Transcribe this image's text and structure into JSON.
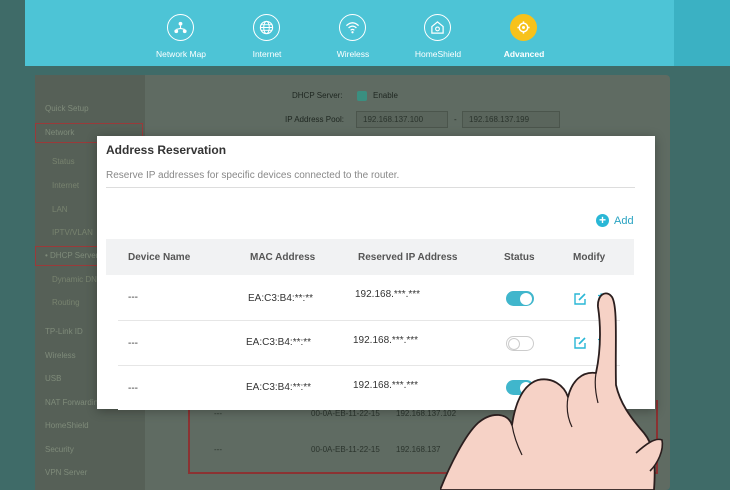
{
  "nav": {
    "items": [
      {
        "label": "Network Map",
        "icon": "network-map-icon"
      },
      {
        "label": "Internet",
        "icon": "globe-icon"
      },
      {
        "label": "Wireless",
        "icon": "wifi-icon"
      },
      {
        "label": "HomeShield",
        "icon": "homeshield-icon"
      },
      {
        "label": "Advanced",
        "icon": "gear-icon",
        "active": true
      }
    ],
    "accent": "#4dc4d6",
    "active_color": "#f7c21b"
  },
  "sidebar": {
    "quick_setup": "Quick Setup",
    "network": "Network",
    "status": "Status",
    "internet": "Internet",
    "lan": "LAN",
    "iptv": "IPTV/VLAN",
    "dhcp": "• DHCP Server",
    "ddns": "Dynamic DNS",
    "routing": "Routing",
    "tplink_id": "TP-Link ID",
    "wireless": "Wireless",
    "usb": "USB",
    "nat": "NAT Forwarding",
    "homeshield": "HomeShield",
    "security": "Security",
    "vpn": "VPN Server"
  },
  "bgform": {
    "dhcp_label": "DHCP Server:",
    "enable_label": "Enable",
    "pool_label": "IP Address Pool:",
    "pool_start": "192.168.137.100",
    "pool_dash": "-",
    "pool_end": "192.168.137.199",
    "rows": [
      {
        "name": "---",
        "mac": "00-0A-EB-11-22-15",
        "ip": "192.168.137.102"
      },
      {
        "name": "---",
        "mac": "00-0A-EB-11-22-15",
        "ip": "192.168.137"
      }
    ]
  },
  "modal": {
    "title": "Address Reservation",
    "description": "Reserve IP addresses for specific devices connected to the router.",
    "add_label": "Add",
    "columns": {
      "device_name": "Device Name",
      "mac": "MAC Address",
      "reserved_ip": "Reserved IP Address",
      "status": "Status",
      "modify": "Modify"
    },
    "rows": [
      {
        "device": "---",
        "mac": "EA:C3:B4:**:**",
        "ip": "192.168.***.***",
        "status": "on"
      },
      {
        "device": "---",
        "mac": "EA:C3:B4:**:**",
        "ip": "192.168.***.***",
        "status": "off"
      },
      {
        "device": "---",
        "mac": "EA:C3:B4:**:**",
        "ip": "192.168.***.***",
        "status": "on"
      }
    ]
  }
}
